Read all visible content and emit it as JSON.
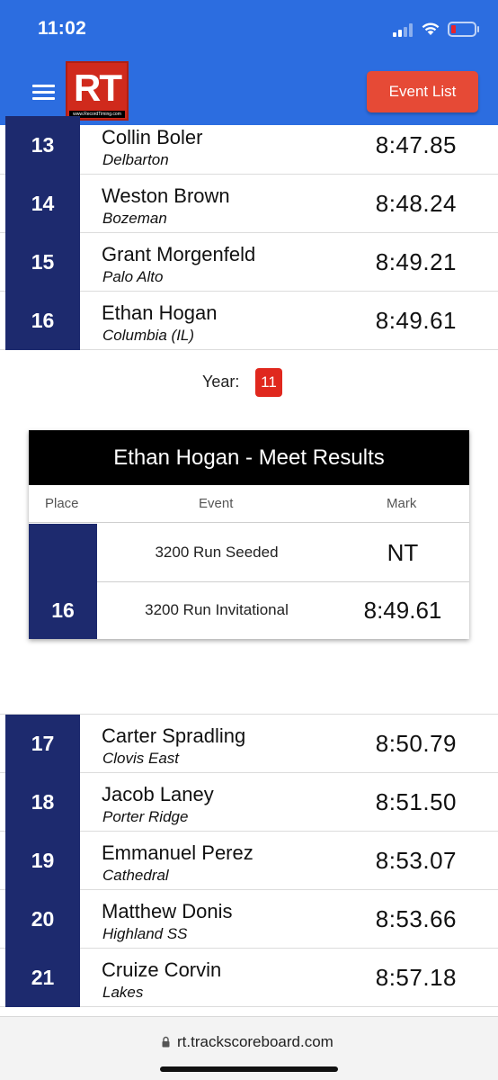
{
  "status_bar": {
    "time": "11:02"
  },
  "header": {
    "logo_text": "RT",
    "logo_subtext": "www.RecordTiming.com",
    "event_list_label": "Event List",
    "accent_color": "#2c6de0"
  },
  "results_top": [
    {
      "place": "13",
      "name": "Collin Boler",
      "school": "Delbarton",
      "mark": "8:47.85"
    },
    {
      "place": "14",
      "name": "Weston Brown",
      "school": "Bozeman",
      "mark": "8:48.24"
    },
    {
      "place": "15",
      "name": "Grant Morgenfeld",
      "school": "Palo Alto",
      "mark": "8:49.21"
    },
    {
      "place": "16",
      "name": "Ethan Hogan",
      "school": "Columbia (IL)",
      "mark": "8:49.61"
    }
  ],
  "athlete_detail": {
    "year_label": "Year:",
    "year_value": "11",
    "card_title": "Ethan Hogan - Meet Results",
    "columns": {
      "place": "Place",
      "event": "Event",
      "mark": "Mark"
    },
    "rows": [
      {
        "place": "",
        "event": "3200 Run Seeded",
        "mark": "NT"
      },
      {
        "place": "16",
        "event": "3200 Run Invitational",
        "mark": "8:49.61"
      }
    ]
  },
  "results_bottom": [
    {
      "place": "17",
      "name": "Carter Spradling",
      "school": "Clovis East",
      "mark": "8:50.79"
    },
    {
      "place": "18",
      "name": "Jacob Laney",
      "school": "Porter Ridge",
      "mark": "8:51.50"
    },
    {
      "place": "19",
      "name": "Emmanuel Perez",
      "school": "Cathedral",
      "mark": "8:53.07"
    },
    {
      "place": "20",
      "name": "Matthew Donis",
      "school": "Highland SS",
      "mark": "8:53.66"
    },
    {
      "place": "21",
      "name": "Cruize Corvin",
      "school": "Lakes",
      "mark": "8:57.18"
    }
  ],
  "browser": {
    "url": "rt.trackscoreboard.com"
  },
  "colors": {
    "place_bg": "#1d2a6e",
    "event_list_button": "#e64a36",
    "year_badge": "#e0281e",
    "logo_red": "#d02a1c"
  }
}
